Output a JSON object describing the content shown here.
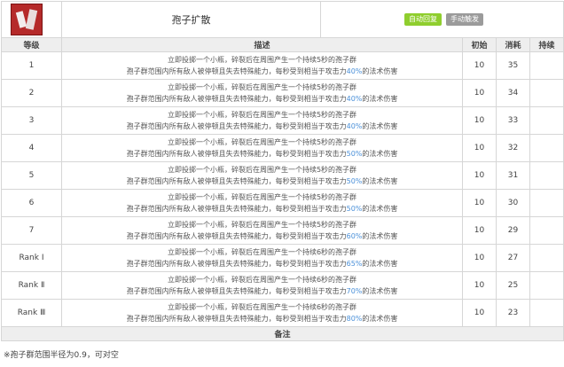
{
  "skill": {
    "icon": "flask-shatter-icon",
    "name": "孢子扩散",
    "tags": [
      "自动回复",
      "手动触发"
    ]
  },
  "columns": {
    "level": "等级",
    "desc": "描述",
    "initial": "初始",
    "cost": "消耗",
    "duration": "持续"
  },
  "rows": [
    {
      "level": "1",
      "line1": "立即投掷一个小瓶，碎裂后在周围产生一个持续5秒的孢子群",
      "line2a": "孢子群范围内所有敌人被停顿且失去特殊能力，每秒受到相当于攻击力",
      "pct": "40%",
      "line2b": "的法术伤害",
      "initial": "10",
      "cost": "35",
      "duration": ""
    },
    {
      "level": "2",
      "line1": "立即投掷一个小瓶，碎裂后在周围产生一个持续5秒的孢子群",
      "line2a": "孢子群范围内所有敌人被停顿且失去特殊能力，每秒受到相当于攻击力",
      "pct": "40%",
      "line2b": "的法术伤害",
      "initial": "10",
      "cost": "34",
      "duration": ""
    },
    {
      "level": "3",
      "line1": "立即投掷一个小瓶，碎裂后在周围产生一个持续5秒的孢子群",
      "line2a": "孢子群范围内所有敌人被停顿且失去特殊能力，每秒受到相当于攻击力",
      "pct": "40%",
      "line2b": "的法术伤害",
      "initial": "10",
      "cost": "33",
      "duration": ""
    },
    {
      "level": "4",
      "line1": "立即投掷一个小瓶，碎裂后在周围产生一个持续5秒的孢子群",
      "line2a": "孢子群范围内所有敌人被停顿且失去特殊能力，每秒受到相当于攻击力",
      "pct": "50%",
      "line2b": "的法术伤害",
      "initial": "10",
      "cost": "32",
      "duration": ""
    },
    {
      "level": "5",
      "line1": "立即投掷一个小瓶，碎裂后在周围产生一个持续5秒的孢子群",
      "line2a": "孢子群范围内所有敌人被停顿且失去特殊能力，每秒受到相当于攻击力",
      "pct": "50%",
      "line2b": "的法术伤害",
      "initial": "10",
      "cost": "31",
      "duration": ""
    },
    {
      "level": "6",
      "line1": "立即投掷一个小瓶，碎裂后在周围产生一个持续5秒的孢子群",
      "line2a": "孢子群范围内所有敌人被停顿且失去特殊能力，每秒受到相当于攻击力",
      "pct": "50%",
      "line2b": "的法术伤害",
      "initial": "10",
      "cost": "30",
      "duration": ""
    },
    {
      "level": "7",
      "line1": "立即投掷一个小瓶，碎裂后在周围产生一个持续5秒的孢子群",
      "line2a": "孢子群范围内所有敌人被停顿且失去特殊能力，每秒受到相当于攻击力",
      "pct": "60%",
      "line2b": "的法术伤害",
      "initial": "10",
      "cost": "29",
      "duration": ""
    },
    {
      "level": "Rank Ⅰ",
      "line1": "立即投掷一个小瓶，碎裂后在周围产生一个持续6秒的孢子群",
      "line2a": "孢子群范围内所有敌人被停顿且失去特殊能力，每秒受到相当于攻击力",
      "pct": "65%",
      "line2b": "的法术伤害",
      "initial": "10",
      "cost": "27",
      "duration": ""
    },
    {
      "level": "Rank Ⅱ",
      "line1": "立即投掷一个小瓶，碎裂后在周围产生一个持续6秒的孢子群",
      "line2a": "孢子群范围内所有敌人被停顿且失去特殊能力，每秒受到相当于攻击力",
      "pct": "70%",
      "line2b": "的法术伤害",
      "initial": "10",
      "cost": "25",
      "duration": ""
    },
    {
      "level": "Rank Ⅲ",
      "line1": "立即投掷一个小瓶，碎裂后在周围产生一个持续6秒的孢子群",
      "line2a": "孢子群范围内所有敌人被停顿且失去特殊能力，每秒受到相当于攻击力",
      "pct": "80%",
      "line2b": "的法术伤害",
      "initial": "10",
      "cost": "23",
      "duration": ""
    }
  ],
  "notes_header": "备注",
  "footnote": "※孢子群范围半径为0.9，可对空",
  "colors": {
    "highlight": "#4a90d9",
    "auto_tag": "#8fce2e",
    "manual_tag": "#9b9b9b",
    "icon_bg": "#b52a2a"
  }
}
